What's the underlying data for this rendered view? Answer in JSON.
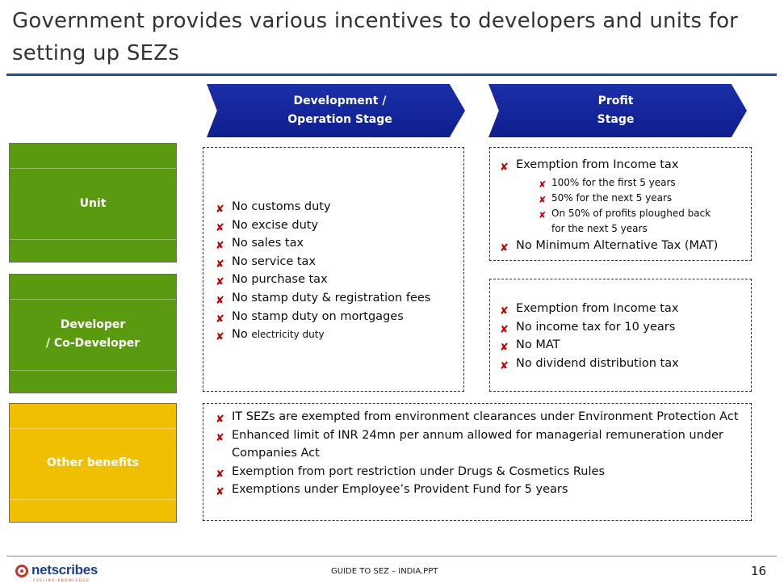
{
  "title": "Government provides various incentives to developers and units for setting up SEZs",
  "stages": [
    {
      "line1": "Development /",
      "line2": "Operation Stage"
    },
    {
      "line1": "Profit",
      "line2": "Stage"
    }
  ],
  "rows": [
    {
      "label1": "Unit",
      "label2": "",
      "color": "#5a9a0f"
    },
    {
      "label1": "Developer",
      "label2": "/ Co-Developer",
      "color": "#5a9a0f"
    },
    {
      "label1": "Other benefits",
      "label2": "",
      "color": "#f0c000"
    }
  ],
  "bullet_glyph": "✘",
  "development_benefits": [
    "No customs duty",
    "No excise duty",
    "No sales tax",
    "No service tax",
    "No purchase tax",
    "No stamp duty & registration fees",
    "No stamp duty on mortgages"
  ],
  "development_last": {
    "prefix": "No",
    "suffix": "electricity duty"
  },
  "unit_profit": {
    "main": "Exemption from Income tax",
    "sub": [
      "100% for the first 5 years",
      "50% for the next 5 years",
      "On 50% of profits ploughed back for the next 5 years"
    ],
    "last": "No Minimum Alternative Tax (MAT)"
  },
  "developer_profit": [
    "Exemption from Income tax",
    "No income tax for 10 years",
    "No MAT",
    "No dividend distribution tax"
  ],
  "other_benefits": [
    "IT SEZs are exempted from environment clearances under Environment Protection Act",
    "Enhanced limit of INR 24mn per annum allowed for managerial remuneration under Companies Act",
    "Exemption from port restriction under Drugs & Cosmetics Rules",
    "Exemptions under Employee’s Provident Fund for 5 years"
  ],
  "footer": {
    "logo_name": "netscribes",
    "logo_tagline": "FUELING KNOWLEDGE",
    "center_text": "GUIDE TO SEZ – INDIA.PPT",
    "page_number": "16"
  }
}
